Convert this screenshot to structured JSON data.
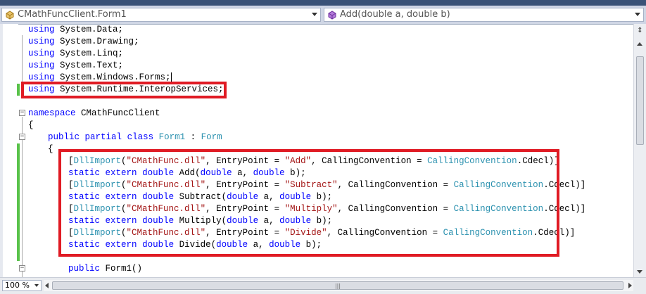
{
  "nav": {
    "class_combo": "CMathFuncClient.Form1",
    "member_combo": "Add(double a, double b)"
  },
  "code": {
    "l1_kw": "using",
    "l1_rest": " System.Data;",
    "l2_kw": "using",
    "l2_rest": " System.Drawing;",
    "l3_kw": "using",
    "l3_rest": " System.Linq;",
    "l4_kw": "using",
    "l4_rest": " System.Text;",
    "l5_kw": "using",
    "l5_rest": " System.Windows.Forms;",
    "l6_kw": "using",
    "l6_rest": " System.Runtime.InteropServices;",
    "l8_kw": "namespace",
    "l8_rest": " CMathFuncClient",
    "l9": "{",
    "l10_kw1": "public",
    "l10_kw2": "partial",
    "l10_kw3": "class",
    "l10_ty1": "Form1",
    "l10_colon": " : ",
    "l10_ty2": "Form",
    "l11": "{",
    "import_open": "[",
    "dllimport": "DllImport",
    "paren_open": "(",
    "dll_name": "\"CMathFunc.dll\"",
    "entry_sep": ", EntryPoint = ",
    "ep_add": "\"Add\"",
    "ep_sub": "\"Subtract\"",
    "ep_mul": "\"Multiply\"",
    "ep_div": "\"Divide\"",
    "cc_sep": ", CallingConvention = ",
    "cc_type": "CallingConvention",
    "cc_tail": ".Cdecl)]",
    "kw_static": "static",
    "kw_extern": "extern",
    "kw_double": "double",
    "fn_add": " Add(",
    "fn_sub": " Subtract(",
    "fn_mul": " Multiply(",
    "fn_div": " Divide(",
    "arg_a": " a, ",
    "arg_b": " b);",
    "l21_kw": "public",
    "l21_rest": " Form1()"
  },
  "zoom": "100 %",
  "colors": {
    "keyword": "#0000ff",
    "type": "#2b91af",
    "string": "#a31515",
    "highlight_box": "#e01b24",
    "change_bar": "#59c24a"
  },
  "icons": {
    "class_icon": "class-icon",
    "method_icon": "method-icon"
  }
}
